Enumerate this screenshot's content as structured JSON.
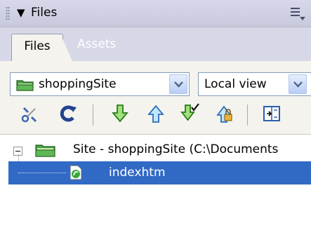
{
  "panel": {
    "title": "Files",
    "title_arrow": "▼",
    "tabs": [
      "Files",
      "Assets"
    ]
  },
  "controls": {
    "site_select": "shoppingSite",
    "view_select": "Local view"
  },
  "toolbar": {
    "buttons": [
      "connect-icon",
      "refresh-icon",
      "get-files-icon",
      "put-files-icon",
      "check-out-icon",
      "check-in-icon",
      "expand-icon"
    ]
  },
  "tree": {
    "site_row": "Site - shoppingSite (C:\\Documents",
    "file_row": "indexhtm"
  },
  "colors": {
    "titlebar": "#d7d8e9",
    "selection": "#316ac5",
    "panel_bg": "#f4f3ee"
  }
}
